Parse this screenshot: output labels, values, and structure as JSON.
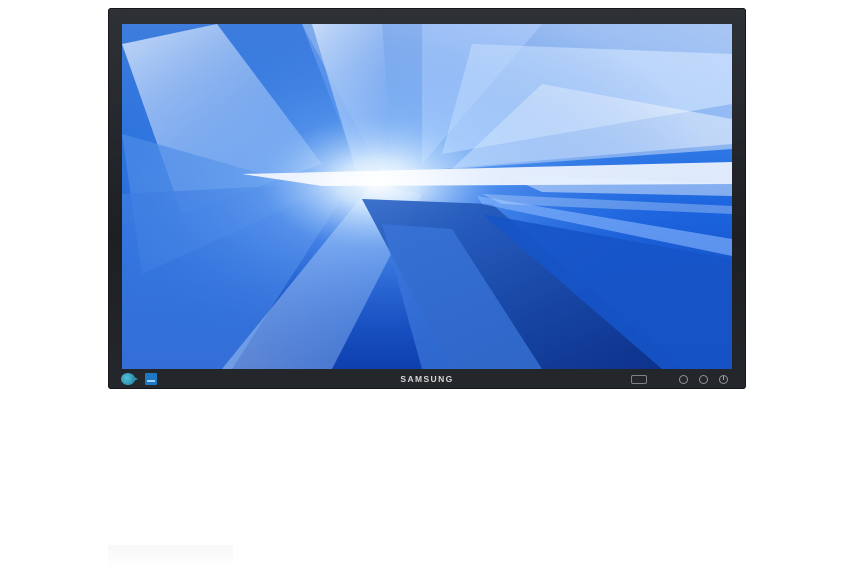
{
  "product": {
    "brand_label": "SAMSUNG",
    "screen_wallpaper": "blue-abstract-light-rays"
  },
  "bezel_controls": [
    {
      "name": "menu-button"
    },
    {
      "name": "navigation-arrows"
    },
    {
      "name": "enter-button"
    },
    {
      "name": "source-button"
    },
    {
      "name": "auto-button"
    },
    {
      "name": "power-button"
    }
  ],
  "colors": {
    "bezel": "#1f2125",
    "screen_primary": "#1a5fd6",
    "screen_highlight": "#e8f2ff"
  }
}
